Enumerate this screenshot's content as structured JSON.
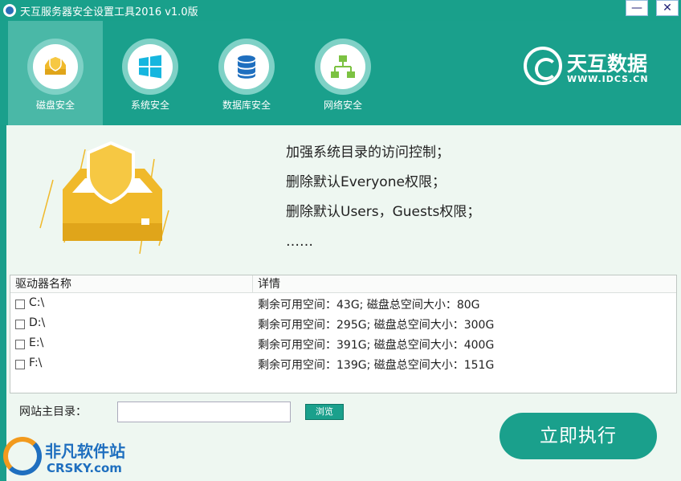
{
  "window": {
    "title": "天互服务器安全设置工具2016 v1.0版",
    "minimize_label": "—",
    "close_label": "✕"
  },
  "nav": {
    "items": [
      {
        "label": "磁盘安全",
        "icon": "disk-shield-icon",
        "active": true
      },
      {
        "label": "系统安全",
        "icon": "windows-icon",
        "active": false
      },
      {
        "label": "数据库安全",
        "icon": "database-icon",
        "active": false
      },
      {
        "label": "网络安全",
        "icon": "network-icon",
        "active": false
      }
    ]
  },
  "brand": {
    "name": "天互数据",
    "url": "WWW.IDCS.CN"
  },
  "description": {
    "lines": [
      "加强系统目录的访问控制；",
      "删除默认Everyone权限；",
      "删除默认Users，Guests权限；",
      "……"
    ]
  },
  "table": {
    "headers": [
      "驱动器名称",
      "详情"
    ],
    "rows": [
      {
        "name": "C:\\",
        "detail": "剩余可用空间：43G; 磁盘总空间大小：80G",
        "checked": false
      },
      {
        "name": "D:\\",
        "detail": "剩余可用空间：295G; 磁盘总空间大小：300G",
        "checked": false
      },
      {
        "name": "E:\\",
        "detail": "剩余可用空间：391G; 磁盘总空间大小：400G",
        "checked": false
      },
      {
        "name": "F:\\",
        "detail": "剩余可用空间：139G; 磁盘总空间大小：151G",
        "checked": false
      }
    ]
  },
  "site": {
    "label": "网站主目录：",
    "value": "",
    "placeholder": "",
    "browse_label": "浏览"
  },
  "execute_label": "立即执行",
  "watermark": {
    "cn": "非凡软件站",
    "en": "CRSKY.com"
  },
  "colors": {
    "primary": "#1aa08c",
    "active_tab": "#4ab8a7",
    "accent_yellow": "#f0b92a",
    "content_bg": "#eef7f1"
  }
}
